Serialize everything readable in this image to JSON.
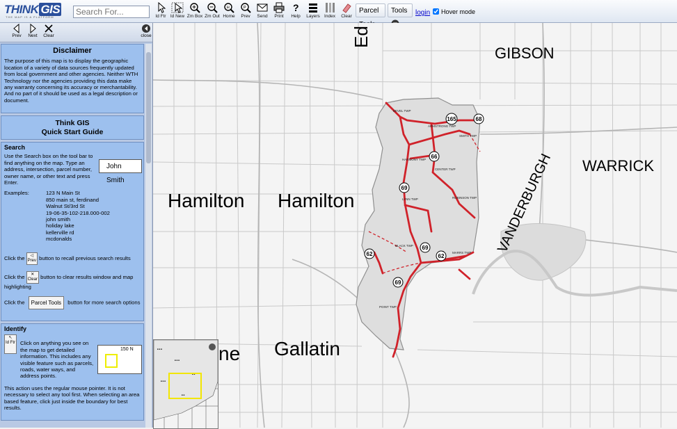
{
  "toolbar": {
    "search_placeholder": "Search For...",
    "buttons": [
      {
        "label": "Id Ftr",
        "icon": "pointer-icon"
      },
      {
        "label": "Id New",
        "icon": "pointer-new-icon"
      },
      {
        "label": "Zm Box",
        "icon": "zoom-box-icon"
      },
      {
        "label": "Zm Out",
        "icon": "zoom-out-icon"
      },
      {
        "label": "Home",
        "icon": "home-icon"
      },
      {
        "label": "Prev",
        "icon": "prev-zoom-icon"
      },
      {
        "label": "Send",
        "icon": "mail-icon"
      },
      {
        "label": "Print",
        "icon": "printer-icon"
      },
      {
        "label": "Help",
        "icon": "help-icon"
      },
      {
        "label": "Layers",
        "icon": "layers-icon"
      },
      {
        "label": "Index",
        "icon": "index-icon"
      },
      {
        "label": "Clear",
        "icon": "eraser-icon"
      }
    ],
    "parcel_tools": "Parcel Tools",
    "tools": "Tools",
    "login": "login",
    "hover_mode": "Hover mode",
    "hover_checked": true
  },
  "panel": {
    "prev": "Prev",
    "next": "Next",
    "clear": "Clear",
    "close": "close",
    "disclaimer_title": "Disclaimer",
    "disclaimer_text": "The purpose of this map is to display the geographic location of a variety of data sources frequently updated from local government and other agencies. Neither WTH Technology nor the agencies providing this data make any warranty concerning its accuracy or merchantability. And no part of it should be used as a legal description or document.",
    "quickstart_title_1": "Think GIS",
    "quickstart_title_2": "Quick Start Guide",
    "search_heading": "Search",
    "search_text": "Use the Search box on the tool bar to find anything on the map. Type an address, intersection, parcel number, owner name, or other text and press Enter.",
    "search_example_box": "John Smith",
    "examples_label": "Examples:",
    "examples": [
      "123 N Main St",
      "850 main st, ferdinand",
      "Walnut St/3rd St",
      "19-06-35-102-218.000-002",
      "john smith",
      "holiday lake",
      "kellerville rd",
      "mcdonalds"
    ],
    "click_the": "Click the",
    "prev_text": "button to recall previous search results",
    "clear_text": "button to clear results window and map highlighting",
    "parcel_text": "button for more search options",
    "identify_heading": "Identify",
    "identify_text": "Click on anything you see on the map to get detailed information. This includes any visible feature such as parcels, roads, water ways, and address points.",
    "identify_text2": "This action uses the regular mouse pointer. It is not necessary to select any tool first. When selecting an area based feature, click just inside the boundary for best results.",
    "id_ftr": "Id Ftr",
    "overview_number": "150 N"
  },
  "map": {
    "labels": [
      "Hamilton",
      "Hamilton",
      "GIBSON",
      "WARRICK",
      "VANDERBURGH",
      "Gallatin",
      "ne",
      "Ed"
    ],
    "townships": [
      "BEVEL TWP",
      "ARMSTRONG TWP",
      "SMITH TWP",
      "HARMONY TWP",
      "CENTER TWP",
      "LYNN TWP",
      "ROBINSON TWP",
      "BLACK TWP",
      "MARRS TWP",
      "POINT TWP"
    ],
    "route_shields": [
      "165",
      "68",
      "66",
      "69",
      "62",
      "69",
      "62",
      "62",
      "69"
    ]
  }
}
